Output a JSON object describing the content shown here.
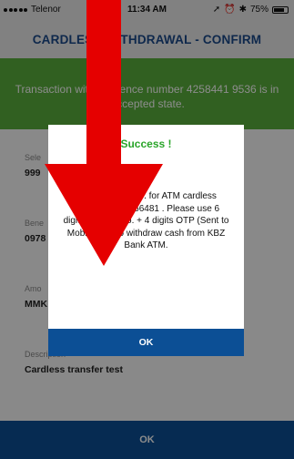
{
  "status_bar": {
    "carrier": "Telenor",
    "time": "11:34 AM",
    "battery": "75%",
    "battery_level": 0.75
  },
  "header": {
    "title": "CARDLESS WITHDRAWAL - CONFIRM"
  },
  "banner": {
    "message": "Transaction with reference number 4258441 9536 is in Accepted state."
  },
  "form": {
    "fields": [
      {
        "label": "Sele",
        "value": "999"
      },
      {
        "label": "Bene",
        "value": "0978"
      },
      {
        "label": "Amo",
        "value": "MMK"
      },
      {
        "label": "Description",
        "value": "Cardless transfer test"
      }
    ],
    "ok_label": "OK"
  },
  "dialog": {
    "title": "Success !",
    "icon": "check-circle-icon",
    "message": "digits account no. for ATM cardless transaction is 366481 . Please use 6 digits account no. + 4 digits OTP (Sent to Mobile No.) to withdraw cash from KBZ Bank ATM.",
    "ok_label": "OK"
  },
  "colors": {
    "header_text": "#1b4a8a",
    "banner_bg": "#5ab03c",
    "success": "#2aa52a",
    "button_bg": "#0c4f95",
    "arrow": "#e50000"
  }
}
